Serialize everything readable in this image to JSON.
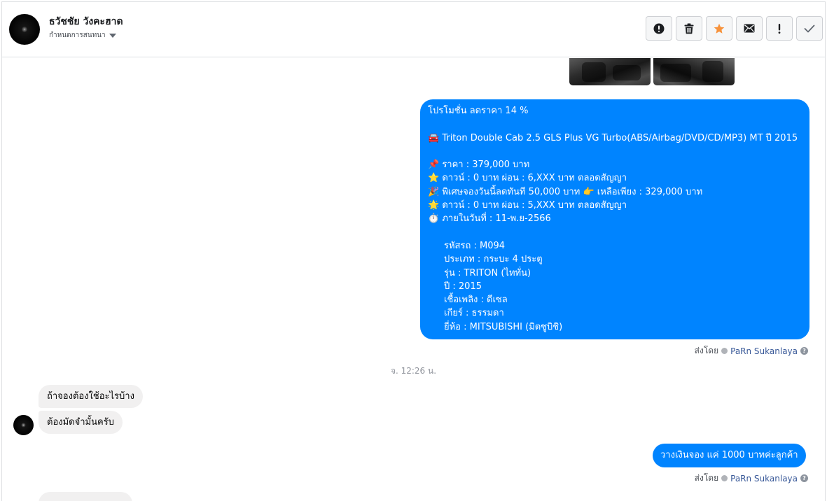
{
  "header": {
    "contact_name": "ธวัชชัย วังคะฮาด",
    "status_label": "กำหนดการสนทนา",
    "actions": [
      {
        "icon": "alert-circle-icon",
        "label": "Mark as spam"
      },
      {
        "icon": "trash-icon",
        "label": "Delete"
      },
      {
        "icon": "star-icon",
        "label": "Star"
      },
      {
        "icon": "envelope-icon",
        "label": "Mark as unread"
      },
      {
        "icon": "exclamation-icon",
        "label": "Follow up"
      },
      {
        "icon": "checkmark-icon",
        "label": "Mark as done"
      }
    ],
    "colors": {
      "star": "#f7923b",
      "icon": "#1c1e21"
    }
  },
  "thread": {
    "promo_message": {
      "lines": [
        "โปรโมชั่น ลดราคา 14 %",
        "",
        "🚘 Triton Double Cab 2.5 GLS Plus VG Turbo(ABS/Airbag/DVD/CD/MP3) MT ปี 2015",
        "",
        "📌 ราคา : 379,000 บาท",
        "⭐ ดาวน์ : 0 บาท ผ่อน : 6,XXX บาท ตลอดสัญญา",
        "🎉 พิเศษจองวันนี้ลดทันที 50,000 บาท 👉 เหลือเพียง : 329,000 บาท",
        "🌟 ดาวน์ : 0 บาท ผ่อน : 5,XXX บาท ตลอดสัญญา",
        "⏱️ ภายในวันที่ : 11-พ.ย-2566",
        ""
      ],
      "details": [
        "รหัสรถ : M094",
        "ประเภท : กระบะ 4 ประตู",
        "รุ่น : TRITON (ไททั่น)",
        "ปี : 2015",
        "เชื้อเพลิง : ดีเซล",
        "เกียร์ : ธรรมดา",
        "ยี่ห้อ : MITSUBISHI (มิตซูบิชิ)"
      ]
    },
    "sent_by_label": "ส่งโดย",
    "sender_name": "PaRn Sukanlaya",
    "time_separator": "จ. 12:26 น.",
    "incoming": [
      "ถ้าจองต้องใช้อะไรบ้าง",
      "ต้องมัดจำมั้นครับ"
    ],
    "reply_message": "วางเงินจอง แค่ 1000 บาทค่ะลูกค้า",
    "colors": {
      "outgoing_bubble": "#0084ff",
      "incoming_bubble": "#f1f0f0"
    }
  }
}
